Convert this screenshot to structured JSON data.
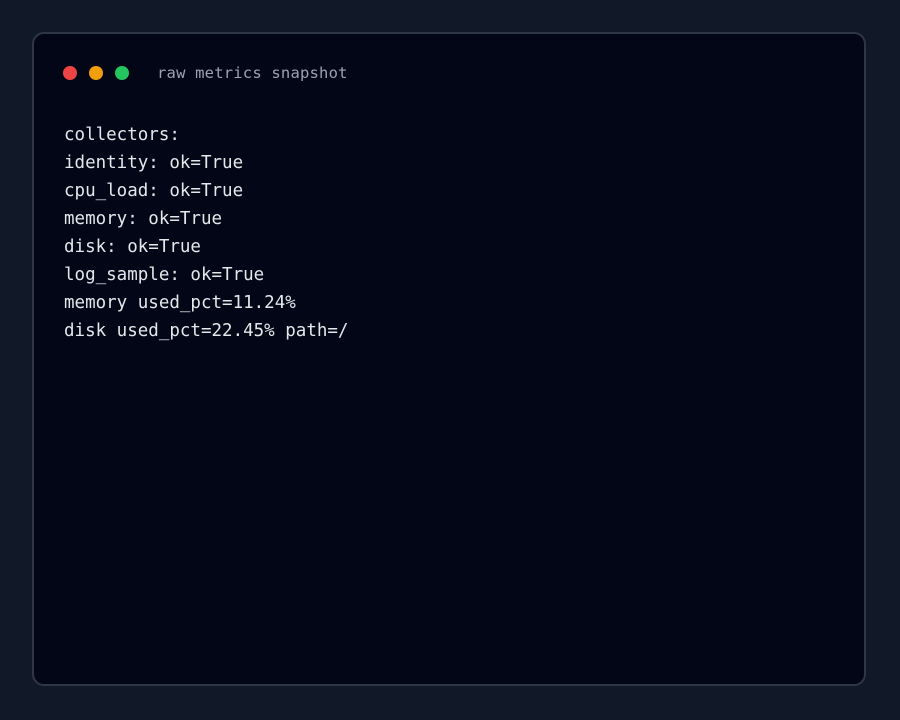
{
  "window": {
    "title": "raw metrics snapshot",
    "controls": [
      {
        "name": "close",
        "color": "#ef4444"
      },
      {
        "name": "minimize",
        "color": "#f59e0b"
      },
      {
        "name": "maximize",
        "color": "#22c55e"
      }
    ]
  },
  "terminal": {
    "lines": [
      "collectors:",
      "identity: ok=True",
      "cpu_load: ok=True",
      "memory: ok=True",
      "disk: ok=True",
      "log_sample: ok=True",
      "memory used_pct=11.24%",
      "disk used_pct=22.45% path=/"
    ]
  }
}
